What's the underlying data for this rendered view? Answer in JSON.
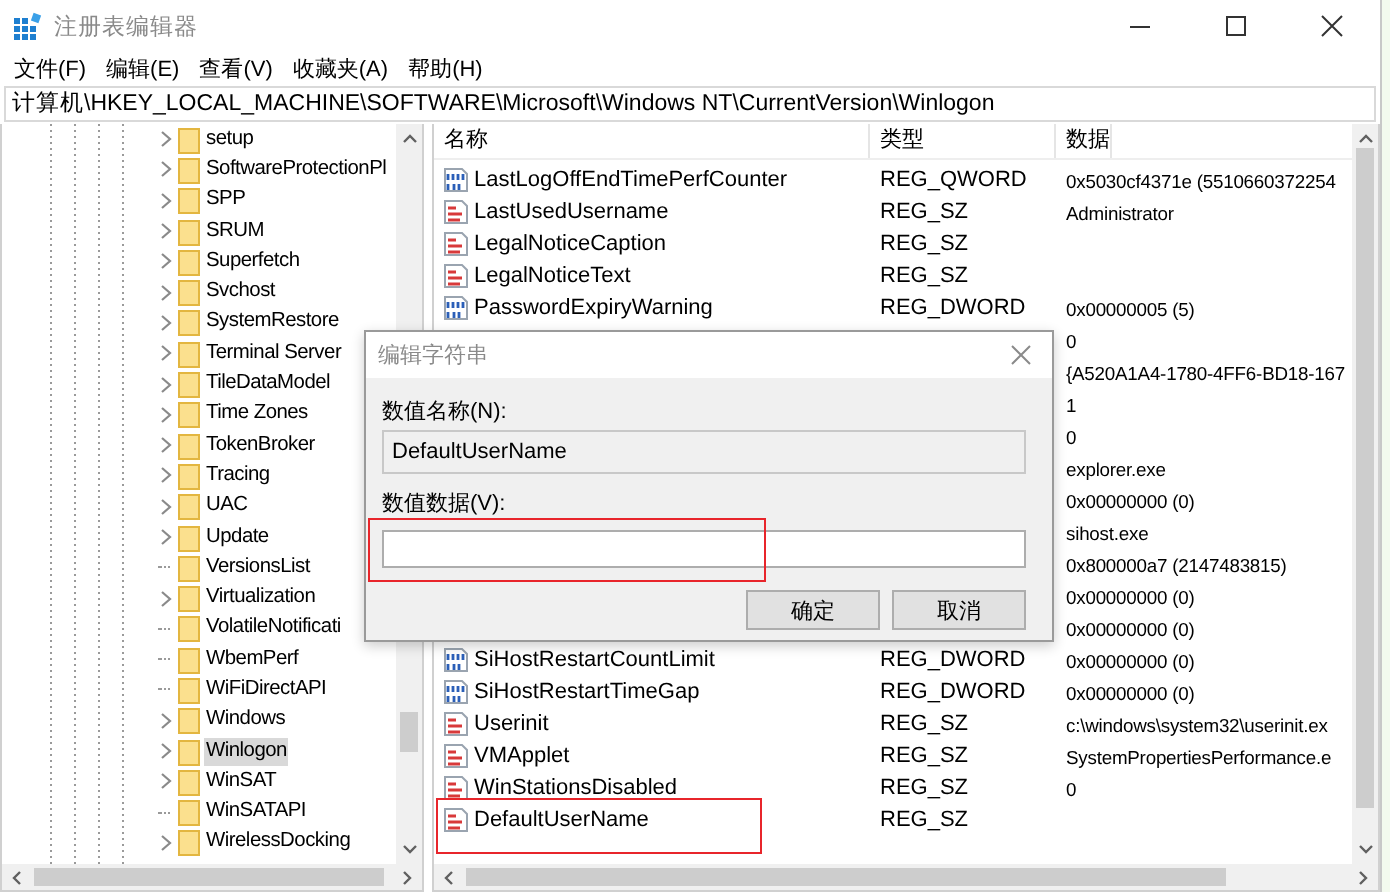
{
  "window": {
    "title": "注册表编辑器"
  },
  "menu": [
    "文件(F)",
    "编辑(E)",
    "查看(V)",
    "收藏夹(A)",
    "帮助(H)"
  ],
  "address": "计算机\\HKEY_LOCAL_MACHINE\\SOFTWARE\\Microsoft\\Windows NT\\CurrentVersion\\Winlogon",
  "tree": {
    "items": [
      {
        "label": "setup",
        "expandable": true,
        "selected": false
      },
      {
        "label": "SoftwareProtectionPl",
        "expandable": true,
        "selected": false
      },
      {
        "label": "SPP",
        "expandable": true,
        "selected": false
      },
      {
        "label": "SRUM",
        "expandable": true,
        "selected": false
      },
      {
        "label": "Superfetch",
        "expandable": true,
        "selected": false
      },
      {
        "label": "Svchost",
        "expandable": true,
        "selected": false
      },
      {
        "label": "SystemRestore",
        "expandable": true,
        "selected": false
      },
      {
        "label": "Terminal Server",
        "expandable": true,
        "selected": false
      },
      {
        "label": "TileDataModel",
        "expandable": true,
        "selected": false
      },
      {
        "label": "Time Zones",
        "expandable": true,
        "selected": false
      },
      {
        "label": "TokenBroker",
        "expandable": true,
        "selected": false
      },
      {
        "label": "Tracing",
        "expandable": true,
        "selected": false
      },
      {
        "label": "UAC",
        "expandable": true,
        "selected": false
      },
      {
        "label": "Update",
        "expandable": true,
        "selected": false
      },
      {
        "label": "VersionsList",
        "expandable": false,
        "selected": false
      },
      {
        "label": "Virtualization",
        "expandable": true,
        "selected": false
      },
      {
        "label": "VolatileNotificati",
        "expandable": false,
        "selected": false
      },
      {
        "label": "WbemPerf",
        "expandable": false,
        "selected": false
      },
      {
        "label": "WiFiDirectAPI",
        "expandable": false,
        "selected": false
      },
      {
        "label": "Windows",
        "expandable": true,
        "selected": false
      },
      {
        "label": "Winlogon",
        "expandable": true,
        "selected": true
      },
      {
        "label": "WinSAT",
        "expandable": true,
        "selected": false
      },
      {
        "label": "WinSATAPI",
        "expandable": false,
        "selected": false
      },
      {
        "label": "WirelessDocking",
        "expandable": true,
        "selected": false
      }
    ]
  },
  "list": {
    "columns": [
      "名称",
      "类型",
      "数据"
    ],
    "rows": [
      {
        "kind": "binary",
        "name": "LastLogOffEndTimePerfCounter",
        "type": "REG_QWORD",
        "data": "0x5030cf4371e (5510660372254",
        "highlighted": false
      },
      {
        "kind": "string",
        "name": "LastUsedUsername",
        "type": "REG_SZ",
        "data": "Administrator",
        "highlighted": false
      },
      {
        "kind": "string",
        "name": "LegalNoticeCaption",
        "type": "REG_SZ",
        "highlighted": false
      },
      {
        "kind": "string",
        "name": "LegalNoticeText",
        "type": "REG_SZ",
        "highlighted": false
      },
      {
        "kind": "binary",
        "name": "PasswordExpiryWarning",
        "type": "REG_DWORD",
        "data": "0x00000005 (5)",
        "highlighted": false
      },
      {
        "data": "0",
        "highlighted": false
      },
      {
        "data": "{A520A1A4-1780-4FF6-BD18-167",
        "highlighted": false
      },
      {
        "data": "1",
        "highlighted": false
      },
      {
        "data": "0",
        "highlighted": false
      },
      {
        "data": "explorer.exe",
        "highlighted": false
      },
      {
        "data": "0x00000000 (0)",
        "highlighted": false
      },
      {
        "data": "sihost.exe",
        "highlighted": false
      },
      {
        "data": "0x800000a7 (2147483815)",
        "highlighted": false
      },
      {
        "data": "0x00000000 (0)",
        "highlighted": false
      },
      {
        "data": "0x00000000 (0)",
        "highlighted": false
      },
      {
        "kind": "binary",
        "name": "SiHostRestartCountLimit",
        "type": "REG_DWORD",
        "data": "0x00000000 (0)",
        "highlighted": false
      },
      {
        "kind": "binary",
        "name": "SiHostRestartTimeGap",
        "type": "REG_DWORD",
        "data": "0x00000000 (0)",
        "highlighted": false
      },
      {
        "kind": "string",
        "name": "Userinit",
        "type": "REG_SZ",
        "data": "c:\\windows\\system32\\userinit.ex",
        "highlighted": false
      },
      {
        "kind": "string",
        "name": "VMApplet",
        "type": "REG_SZ",
        "data": "SystemPropertiesPerformance.e",
        "highlighted": false
      },
      {
        "kind": "string",
        "name": "WinStationsDisabled",
        "type": "REG_SZ",
        "data": "0",
        "highlighted": false
      },
      {
        "kind": "string",
        "name": "DefaultUserName",
        "type": "REG_SZ",
        "highlighted": true
      }
    ]
  },
  "dialog": {
    "title": "编辑字符串",
    "name_label": "数值名称(N):",
    "name_value": "DefaultUserName",
    "data_label": "数值数据(V):",
    "data_highlighted": true,
    "buttons": [
      "确定",
      "取消"
    ]
  }
}
